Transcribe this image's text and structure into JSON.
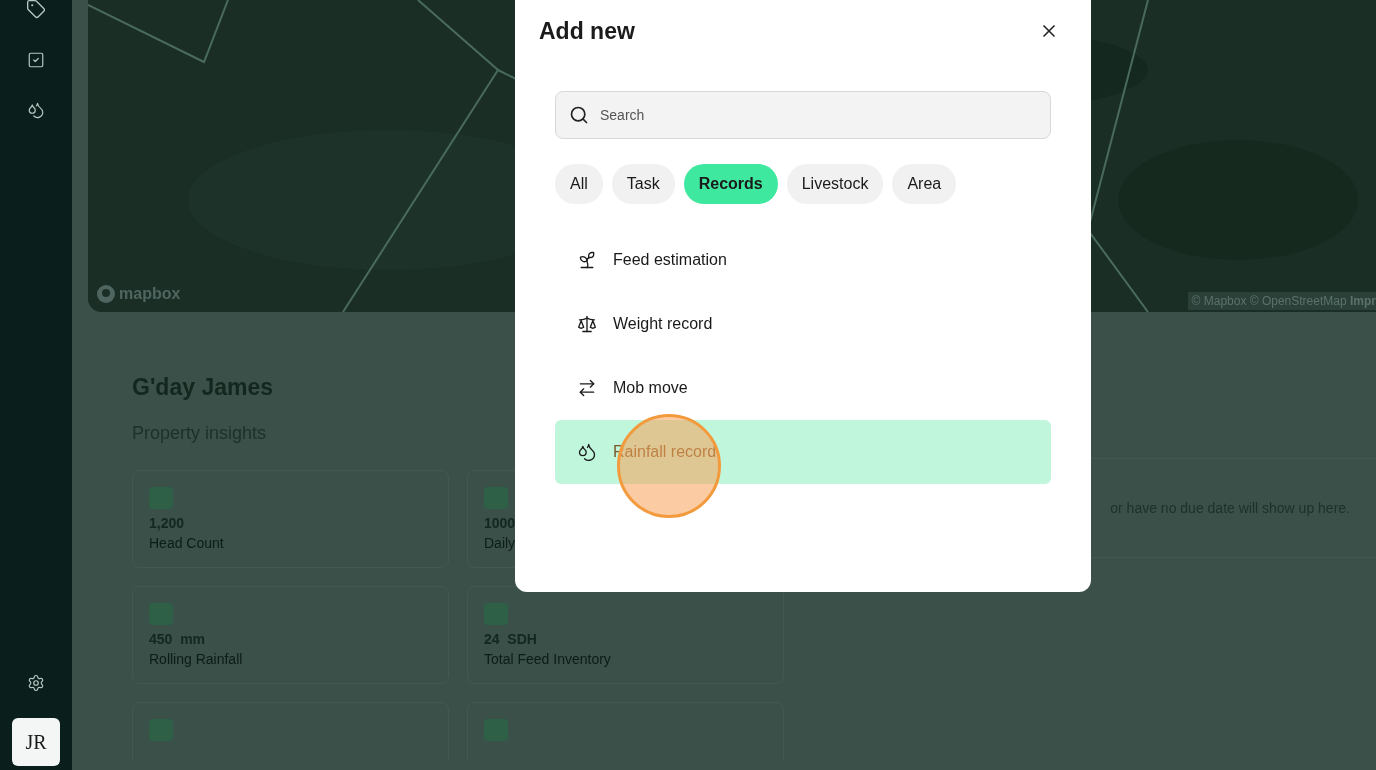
{
  "sidebar": {
    "avatar": "JR"
  },
  "map": {
    "logo": "mapbox",
    "attribution": "© Mapbox © OpenStreetMap",
    "attribution_link": "Impr"
  },
  "dashboard": {
    "greeting": "G'day James",
    "section": "Property insights",
    "stats": [
      {
        "value": "1,200",
        "label": "Head Count"
      },
      {
        "value": "1000",
        "label": "Daily"
      },
      {
        "value": "450  mm",
        "label": "Rolling Rainfall"
      },
      {
        "value": "24  SDH",
        "label": "Total Feed Inventory"
      }
    ],
    "panel_text": "or have no due date will show up here."
  },
  "modal": {
    "title": "Add new",
    "search": {
      "placeholder": "Search"
    },
    "filters": [
      {
        "label": "All",
        "selected": false
      },
      {
        "label": "Task",
        "selected": false
      },
      {
        "label": "Records",
        "selected": true
      },
      {
        "label": "Livestock",
        "selected": false
      },
      {
        "label": "Area",
        "selected": false
      }
    ],
    "items": [
      {
        "kind": "feed",
        "label": "Feed estimation",
        "highlighted": false
      },
      {
        "kind": "weight",
        "label": "Weight record",
        "highlighted": false
      },
      {
        "kind": "move",
        "label": "Mob move",
        "highlighted": false
      },
      {
        "kind": "rainfall",
        "label": "Rainfall record",
        "highlighted": true
      }
    ]
  }
}
